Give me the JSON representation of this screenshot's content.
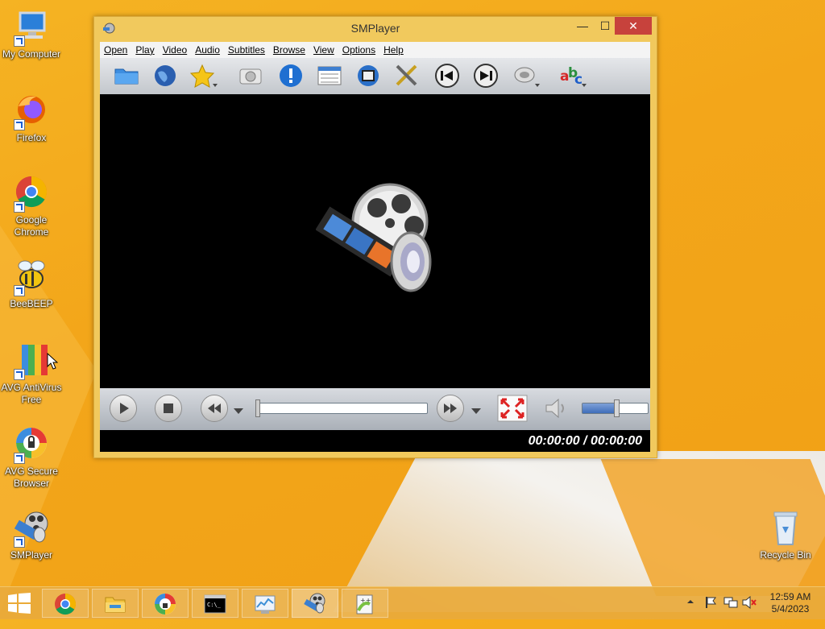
{
  "desktop": {
    "icons": [
      {
        "label": "My Computer",
        "icon": "computer-icon"
      },
      {
        "label": "Firefox",
        "icon": "firefox-icon"
      },
      {
        "label": "Google Chrome",
        "icon": "chrome-icon"
      },
      {
        "label": "BeeBEEP",
        "icon": "beebeep-icon"
      },
      {
        "label": "AVG AntiVirus Free",
        "icon": "avg-antivirus-icon"
      },
      {
        "label": "AVG Secure Browser",
        "icon": "avg-browser-icon"
      },
      {
        "label": "SMPlayer",
        "icon": "smplayer-icon"
      },
      {
        "label": "Recycle Bin",
        "icon": "recycle-bin-icon"
      }
    ]
  },
  "window": {
    "title": "SMPlayer",
    "controls": {
      "minimize": "—",
      "maximize": "☐",
      "close": "✕"
    },
    "menu": [
      "Open",
      "Play",
      "Video",
      "Audio",
      "Subtitles",
      "Browse",
      "View",
      "Options",
      "Help"
    ],
    "toolbar": [
      "open-folder-icon",
      "open-url-icon",
      "favorites-icon",
      "screenshot-icon",
      "info-icon",
      "playlist-icon",
      "video-settings-icon",
      "preferences-icon",
      "previous-icon",
      "next-icon",
      "audio-track-icon",
      "subtitles-icon"
    ],
    "time_display": "00:00:00 / 00:00:00",
    "seek_progress": 0,
    "volume_level": 0.55
  },
  "taskbar": {
    "apps": [
      "start-icon",
      "chrome-icon",
      "file-explorer-icon",
      "avg-browser-icon",
      "command-prompt-icon",
      "resource-monitor-icon",
      "smplayer-icon",
      "notepad-plus-icon"
    ],
    "clock_time": "12:59 AM",
    "clock_date": "5/4/2023"
  },
  "colors": {
    "accent": "#f3a61a",
    "close": "#c7423c"
  }
}
